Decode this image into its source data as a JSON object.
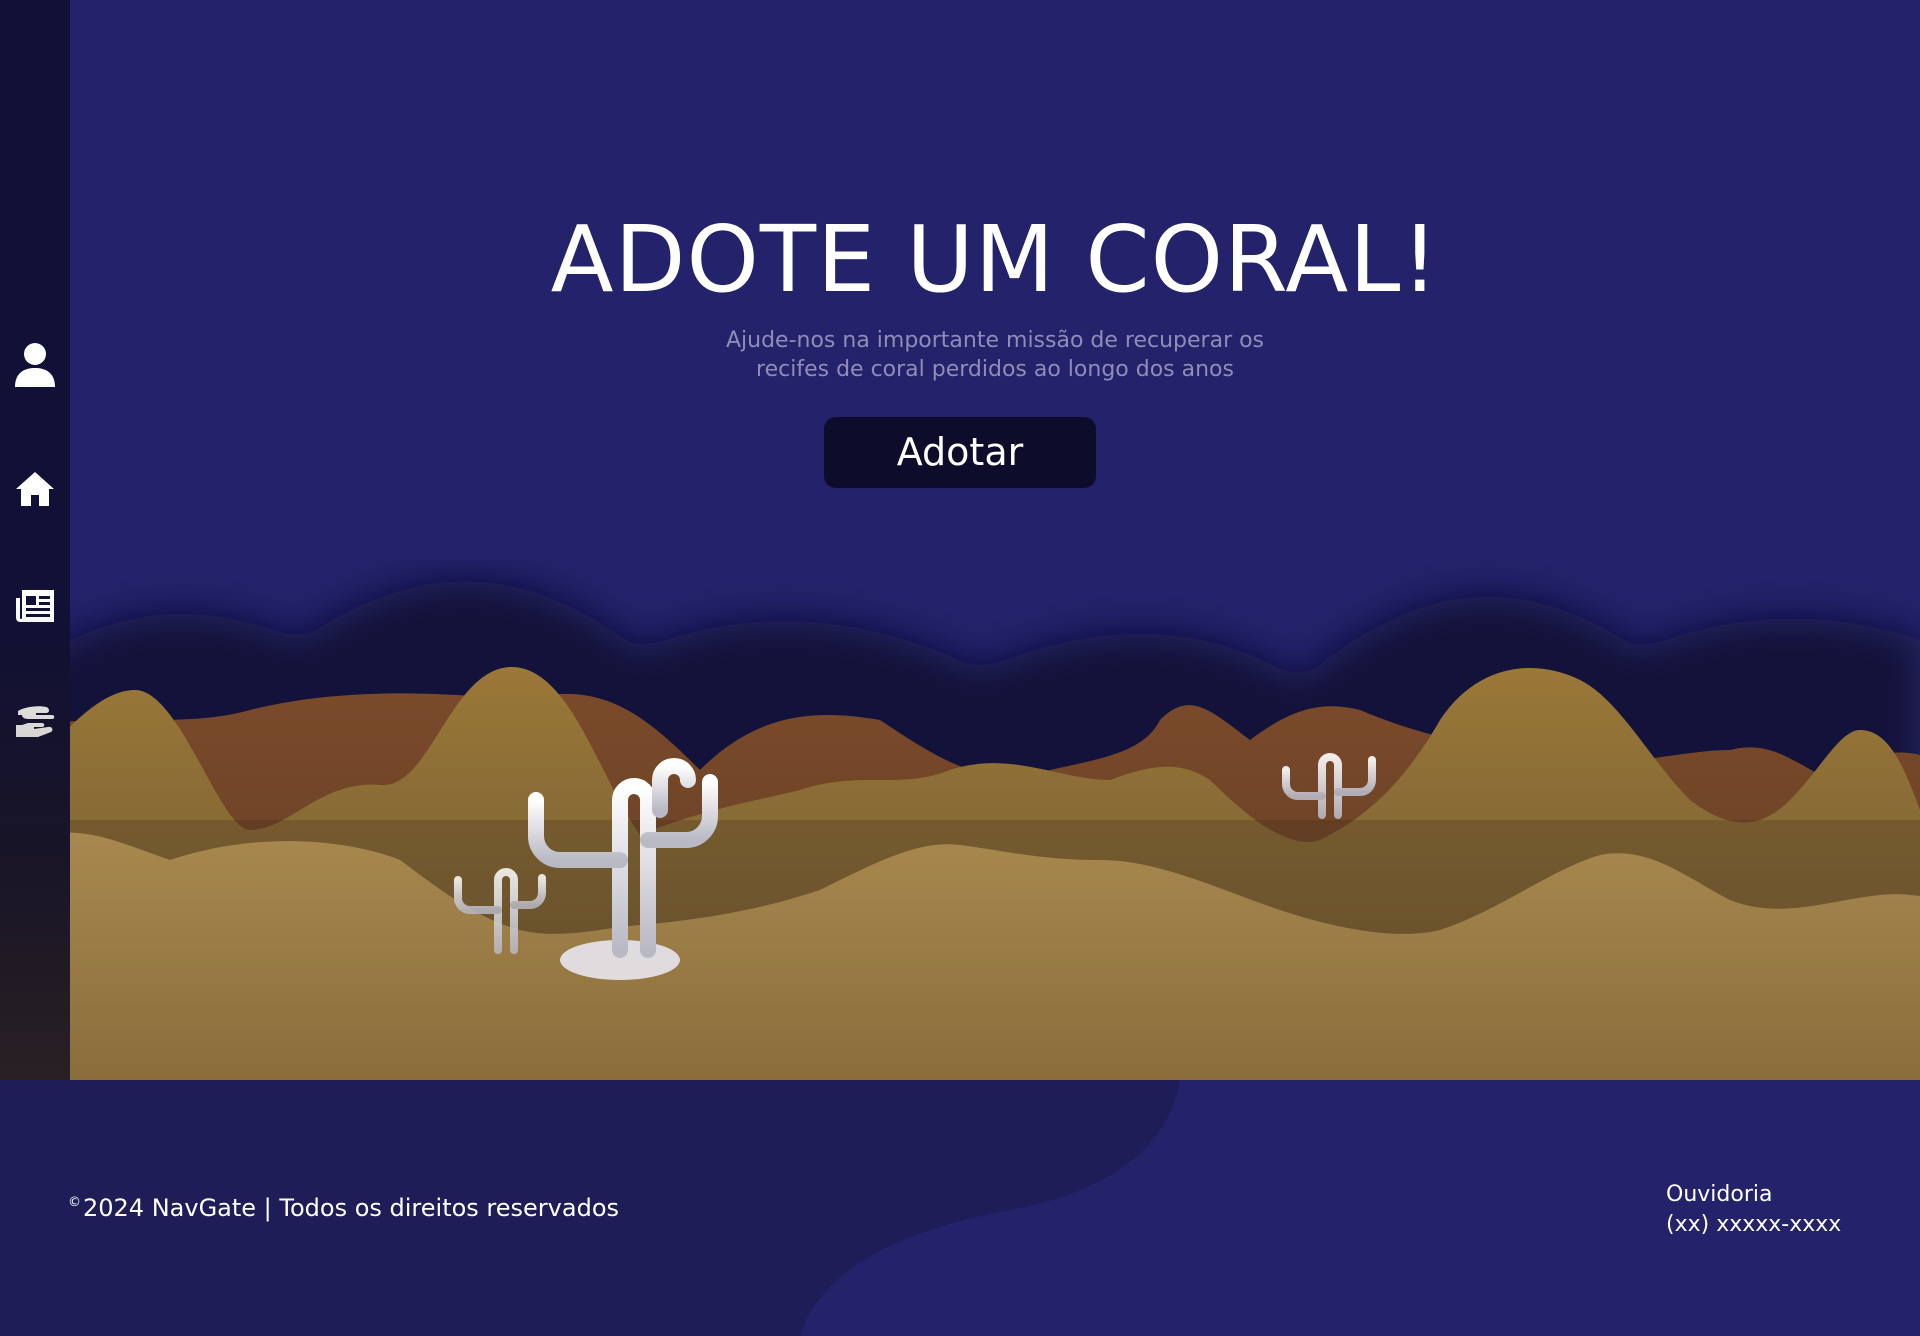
{
  "sidebar": {
    "items": [
      {
        "icon": "user-icon"
      },
      {
        "icon": "home-icon"
      },
      {
        "icon": "newspaper-icon"
      },
      {
        "icon": "hand-holding-icon"
      }
    ]
  },
  "hero": {
    "title": "ADOTE UM CORAL!",
    "subtitle": "Ajude-nos na importante missão de recuperar os recifes de coral perdidos ao longo dos anos",
    "button_label": "Adotar"
  },
  "footer": {
    "copyright_symbol": "©",
    "copyright": "2024 NavGate | Todos os direitos reservados",
    "ombudsman_title": "Ouvidoria",
    "ombudsman_phone": "(xx) xxxxx-xxxx"
  },
  "colors": {
    "background": "#24226a",
    "sidebar": "#111036",
    "button": "#0d0d2b",
    "footer": "#1f1d58",
    "sand": "#a6864c",
    "sand_dark": "#6e4629"
  }
}
